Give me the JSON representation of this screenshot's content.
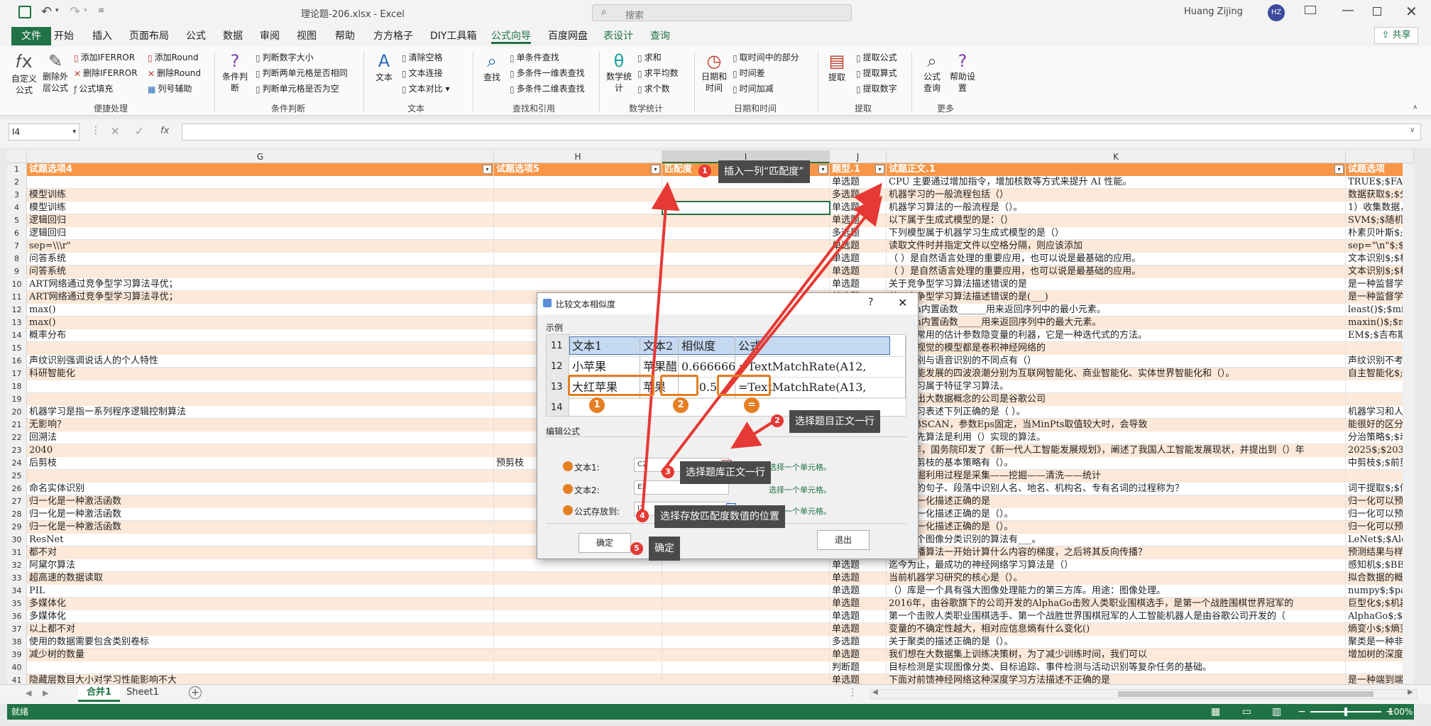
{
  "window": {
    "title": "理论题-206.xlsx  -  Excel",
    "search_placeholder": "搜索",
    "user": "Huang Zijing",
    "avatar": "HZ"
  },
  "tabs": [
    "文件",
    "开始",
    "插入",
    "页面布局",
    "公式",
    "数据",
    "审阅",
    "视图",
    "帮助",
    "方方格子",
    "DIY工具箱",
    "公式向导",
    "百度网盘",
    "表设计",
    "查询"
  ],
  "share": "共享",
  "ribbon": {
    "g1": {
      "b1": "自定义公式",
      "b2": "删除外层公式",
      "s1": "添加IFERROR",
      "s2": "删除IFERROR",
      "s3": "公式填充",
      "s4": "添加Round",
      "s5": "删除Round",
      "s6": "列号辅助",
      "label": "便捷处理"
    },
    "g2": {
      "b1": "条件判断",
      "s1": "判断数字大小",
      "s2": "判断两单元格是否相同",
      "s3": "判断单元格是否为空",
      "label": "条件判断"
    },
    "g3": {
      "b1": "文本",
      "s1": "清除空格",
      "s2": "文本连接",
      "s3": "文本对比",
      "label": "文本"
    },
    "g4": {
      "b1": "查找",
      "s1": "单条件查找",
      "s2": "多条件一维表查找",
      "s3": "多条件二维表查找",
      "label": "查找和引用"
    },
    "g5": {
      "b1": "数学统计",
      "s1": "求和",
      "s2": "求平均数",
      "s3": "求个数",
      "label": "数学统计"
    },
    "g6": {
      "b1": "日期和时间",
      "s1": "取时间中的部分",
      "s2": "时间差",
      "s3": "时间加减",
      "label": "日期和时间"
    },
    "g7": {
      "b1": "提取",
      "s1": "提取公式",
      "s2": "提取算式",
      "s3": "提取数字",
      "label": "提取"
    },
    "g8": {
      "b1": "公式查询",
      "b2": "帮助设置",
      "label": "更多"
    }
  },
  "namebox": "I4",
  "fx": "fx",
  "columns": [
    "G",
    "H",
    "I",
    "J",
    "K"
  ],
  "headers": {
    "g": "试题选项4",
    "h": "试题选项5",
    "i": "匹配度",
    "j": "题型.1",
    "k": "试题正文.1",
    "l": "试题选项"
  },
  "rows": [
    {
      "n": "2",
      "g": "",
      "h": "",
      "j": "单选题",
      "k": "CPU 主要通过增加指令，增加核数等方式来提升 AI 性能。",
      "l": "TRUE$;$FALSE"
    },
    {
      "n": "3",
      "g": "模型训练",
      "h": "",
      "j": "多选题",
      "k": "机器学习的一般流程包括（）",
      "l": "数据获取$;$分"
    },
    {
      "n": "4",
      "g": "模型训练",
      "h": "",
      "j": "单选题",
      "k": "机器学习算法的一般流程是（）。",
      "l": "1）收集数据，"
    },
    {
      "n": "5",
      "g": "逻辑回归",
      "h": "",
      "j": "单选题",
      "k": "以下属于生成式模型的是：（）",
      "l": "SVM$;$随机森"
    },
    {
      "n": "6",
      "g": "逻辑回归",
      "h": "",
      "j": "多选题",
      "k": "下列模型属于机器学习生成式模型的是（）",
      "l": "朴素贝叶斯$;$"
    },
    {
      "n": "7",
      "g": "sep=\\\\\\r\"",
      "h": "",
      "j": "单选题",
      "k": "读取文件时并指定文件以空格分隔，则应该添加",
      "l": "sep=\"\\n\"$;$"
    },
    {
      "n": "8",
      "g": "问答系统",
      "h": "",
      "j": "单选题",
      "k": "（    ）是自然语言处理的重要应用，也可以说是最基础的应用。",
      "l": "文本识别$;$机"
    },
    {
      "n": "9",
      "g": "问答系统",
      "h": "",
      "j": "单选题",
      "k": "（  ）是自然语言处理的重要应用，也可以说是最基础的应用。",
      "l": "文本识别$;$机"
    },
    {
      "n": "10",
      "g": "ART网络通过竞争型学习算法寻优；",
      "h": "",
      "j": "单选题",
      "k": "关于竞争型学习算法描述错误的是",
      "l": "是一种监督学习"
    },
    {
      "n": "11",
      "g": "ART网络通过竞争型学习算法寻优；",
      "h": "",
      "j": "单选题",
      "k": "关于竞争型学习算法描述错误的是(___)",
      "l": "是一种监督学习"
    },
    {
      "n": "12",
      "g": "max()",
      "h": "",
      "j": "单选题",
      "k": "Python内置函数______用来返回序列中的最小元素。",
      "l": "least()$;$mi"
    },
    {
      "n": "13",
      "g": "max()",
      "h": "",
      "j": "单选题",
      "k": "Python内置函数_____用来返回序列中的最大元素。",
      "l": "maxin()$;$ma"
    },
    {
      "n": "14",
      "g": "概率分布",
      "h": "",
      "j": "单选题",
      "k": "（）是常用的估计参数隐变量的利器，它是一种迭代式的方法。",
      "l": "EM$;$吉布斯采"
    },
    {
      "n": "15",
      "g": "",
      "h": "",
      "j": "判断题",
      "k": "计算机视觉的模型都是卷积神经网络的",
      "l": ""
    },
    {
      "n": "16",
      "g": "声纹识别强调说话人的个人特性",
      "h": "",
      "j": "单选题",
      "k": "声纹识别与语音识别的不同点有（）",
      "l": "声纹识别不考虑"
    },
    {
      "n": "17",
      "g": "科研智能化",
      "h": "",
      "j": "单选题",
      "k": "人工智能发展的四波浪潮分别为互联网智能化、商业智能化、实体世界智能化和（）。",
      "l": "自主智能化$;$"
    },
    {
      "n": "18",
      "g": "",
      "h": "",
      "j": "判断题",
      "k": "深度学习属于特征学习算法。",
      "l": ""
    },
    {
      "n": "19",
      "g": "",
      "h": "",
      "j": "判断题",
      "k": "最早提出大数据概念的公司是谷歌公司",
      "l": ""
    },
    {
      "n": "20",
      "g": "机器学习是指一系列程序逻辑控制算法",
      "h": "",
      "j": "单选题",
      "k": "机器学习表述下列正确的是（  ）。",
      "l": "机器学习和人工"
    },
    {
      "n": "21",
      "g": "无影响？",
      "h": "",
      "j": "单选题",
      "k": "使用DBSCAN，参数Eps固定，当MinPts取值较大时，会导致",
      "l": "能很好的区分各"
    },
    {
      "n": "22",
      "g": "回溯法",
      "h": "",
      "j": "单选题",
      "k": "深度优先算法是利用（）实现的算法。",
      "l": "分治策略$;$动"
    },
    {
      "n": "23",
      "g": "2040",
      "h": "",
      "j": "单选题",
      "k": "2017年，国务院印发了《新一代人工智能发展规划》，阐述了我国人工智能发展现状，并提出到（）年",
      "l": "2025$;$2030$"
    },
    {
      "n": "24",
      "g": "后剪枝",
      "h": "预剪枝",
      "j": "多选题",
      "k": "决策树剪枝的基本策略有（）。",
      "l": "中剪枝$;$前剪"
    },
    {
      "n": "25",
      "g": "",
      "h": "",
      "j": "判断题",
      "k": "数据挖掘利用过程是采集——挖掘——清洗——统计",
      "l": ""
    },
    {
      "n": "26",
      "g": "命名实体识别",
      "h": "",
      "j": "单选题",
      "k": "从给定的句子、段落中识别人名、地名、机构名、专有名词的过程称为？",
      "l": "词干提取$;$停"
    },
    {
      "n": "27",
      "g": "归一化是一种激活函数",
      "h": "",
      "j": "单选题",
      "k": "关于归一化描述正确的是",
      "l": "归一化可以预防"
    },
    {
      "n": "28",
      "g": "归一化是一种激活函数",
      "h": "",
      "j": "单选题",
      "k": "关于归一化描述正确的是（）。",
      "l": "归一化可以预防"
    },
    {
      "n": "29",
      "g": "归一化是一种激活函数",
      "h": "",
      "j": "单选题",
      "k": "关于归一化描述正确的是（）。",
      "l": "归一化可以预防"
    },
    {
      "n": "30",
      "g": "ResNet",
      "h": "",
      "j": "单选题",
      "k": "下列哪个图像分类识别的算法有___。",
      "l": "LeNet$;$Alex"
    },
    {
      "n": "31",
      "g": "都不对",
      "h": "",
      "j": "单选题",
      "k": "反向传播算法一开始计算什么内容的梯度，之后将其反向传播？",
      "l": "预测结果与样本"
    },
    {
      "n": "32",
      "g": "阿黛尔算法",
      "h": "",
      "j": "单选题",
      "k": "迄今为止，最成功的神经网络学习算法是（）",
      "l": "感知机$;$BB算"
    },
    {
      "n": "33",
      "g": "超高速的数据读取",
      "h": "",
      "j": "单选题",
      "k": "当前机器学习研究的核心是（）。",
      "l": "拟合数据的概率"
    },
    {
      "n": "34",
      "g": "PIL",
      "h": "",
      "j": "单选题",
      "k": "（）库是一个具有强大图像处理能力的第三方库。用途：图像处理。",
      "l": "numpy$;$pand"
    },
    {
      "n": "35",
      "g": "多媒体化",
      "h": "",
      "j": "单选题",
      "k": "2016年，由谷歌旗下的公司开发的AlphaGo击败人类职业围棋选手，是第一个战胜围棋世界冠军的",
      "l": "巨型化$;$机器"
    },
    {
      "n": "36",
      "g": "多媒体化",
      "h": "",
      "j": "单选题",
      "k": "第一个击败人类职业围棋选手、第一个战胜世界围棋冠军的人工智能机器人是由谷歌公司开发的（",
      "l": "AlphaGo$;$Al"
    },
    {
      "n": "37",
      "g": "以上都不对",
      "h": "",
      "j": "单选题",
      "k": "变量的不确定性越大，相对应信息熵有什么变化()",
      "l": "熵变小$;$熵变"
    },
    {
      "n": "38",
      "g": "使用的数据需要包含类别卷标",
      "h": "",
      "j": "多选题",
      "k": "关于聚类的描述正确的是（）。",
      "l": "聚类是一种非监"
    },
    {
      "n": "39",
      "g": "减少树的数量",
      "h": "",
      "j": "单选题",
      "k": "我们想在大数据集上训练决策树，为了减少训练时间，我们可以",
      "l": "增加树的深度$"
    },
    {
      "n": "40",
      "g": "",
      "h": "",
      "j": "判断题",
      "k": "目标检测是实现图像分类、目标追踪、事件检测与活动识别等复杂任务的基础。",
      "l": ""
    },
    {
      "n": "41",
      "g": "隐藏层数目大小对学习性能影响不大",
      "h": "",
      "j": "单选题",
      "k": "下面对前馈神经网络这种深度学习方法描述不正确的是",
      "l": "是一种端到端"
    }
  ],
  "sheets": [
    "合并1",
    "Sheet1"
  ],
  "status": {
    "ready": "就绪",
    "zoom": "100%"
  },
  "dialog": {
    "title": "比较文本相似度",
    "example_label": "示例",
    "table_rows": [
      {
        "n": "11",
        "a": "文本1",
        "b": "文本2",
        "c": "相似度",
        "d": "公式"
      },
      {
        "n": "12",
        "a": "小苹果",
        "b": "苹果醋",
        "c": "0.66666667",
        "d": "=TextMatchRate(A12,"
      },
      {
        "n": "13",
        "a": "大红苹果",
        "b": "苹果",
        "c": "0.5",
        "d": "=TextMatchRate(A13,"
      },
      {
        "n": "14",
        "a": "",
        "b": "",
        "c": "",
        "d": ""
      }
    ],
    "edit_label": "编辑公式",
    "f1_label": "文本1:",
    "f1_value": "C2",
    "f2_label": "文本2:",
    "f2_value": "E2",
    "f3_label": "公式存放到:",
    "f3_value": "I2",
    "hint": "选择一个单元格。",
    "ok": "确定",
    "exit": "退出"
  },
  "annotations": {
    "a1": "插入一列“匹配度”",
    "a2": "选择题目正文一行",
    "a3": "选择题库正文一行",
    "a4": "选择存放匹配度数值的位置",
    "a5": "确定"
  }
}
